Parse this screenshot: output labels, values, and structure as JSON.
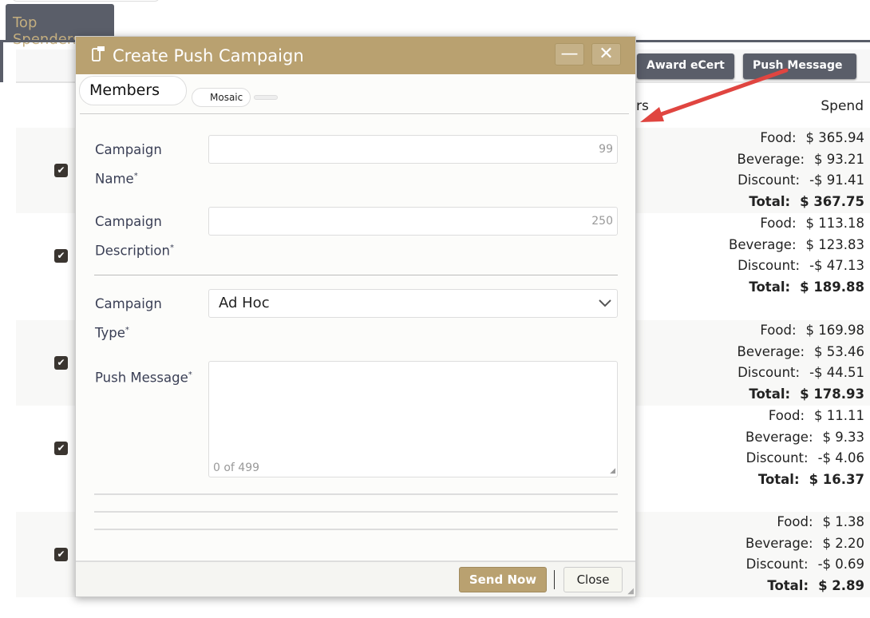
{
  "tab": {
    "label": "Top Spenders"
  },
  "toolbar": {
    "award": "Award eCert",
    "push": "Push Message"
  },
  "table": {
    "spend_header": "Spend",
    "partial_header": "rs",
    "rows": [
      {
        "checked": true,
        "food": "$ 365.94",
        "beverage": "$ 93.21",
        "discount": "-$ 91.41",
        "total": "$ 367.75"
      },
      {
        "checked": true,
        "food": "$ 113.18",
        "beverage": "$ 123.83",
        "discount": "-$ 47.13",
        "total": "$ 189.88"
      },
      {
        "checked": true,
        "food": "$ 169.98",
        "beverage": "$ 53.46",
        "discount": "-$ 44.51",
        "total": "$ 178.93"
      },
      {
        "checked": true,
        "food": "$ 11.11",
        "beverage": "$ 9.33",
        "discount": "-$ 4.06",
        "total": "$ 16.37"
      },
      {
        "checked": true,
        "food": "$ 1.38",
        "beverage": "$ 2.20",
        "discount": "-$ 0.69",
        "total": "$ 2.89"
      }
    ],
    "labels": {
      "food": "Food:",
      "beverage": "Beverage:",
      "discount": "Discount:",
      "total": "Total:"
    }
  },
  "modal": {
    "title": "Create Push Campaign",
    "tabs": [
      "Members",
      "Mosaic"
    ],
    "campaign_name": {
      "label": "Campaign Name",
      "counter": "99",
      "value": ""
    },
    "campaign_description": {
      "label": "Campaign Description",
      "counter": "250",
      "value": ""
    },
    "campaign_type": {
      "label": "Campaign Type",
      "value": "Ad Hoc"
    },
    "push_message": {
      "label": "Push Message",
      "counter": "0 of 499",
      "value": ""
    },
    "required": "*",
    "send": "Send Now",
    "close": "Close"
  },
  "colors": {
    "accent": "#b9a170",
    "dark": "#5a5e69",
    "arrow": "#e04540"
  }
}
